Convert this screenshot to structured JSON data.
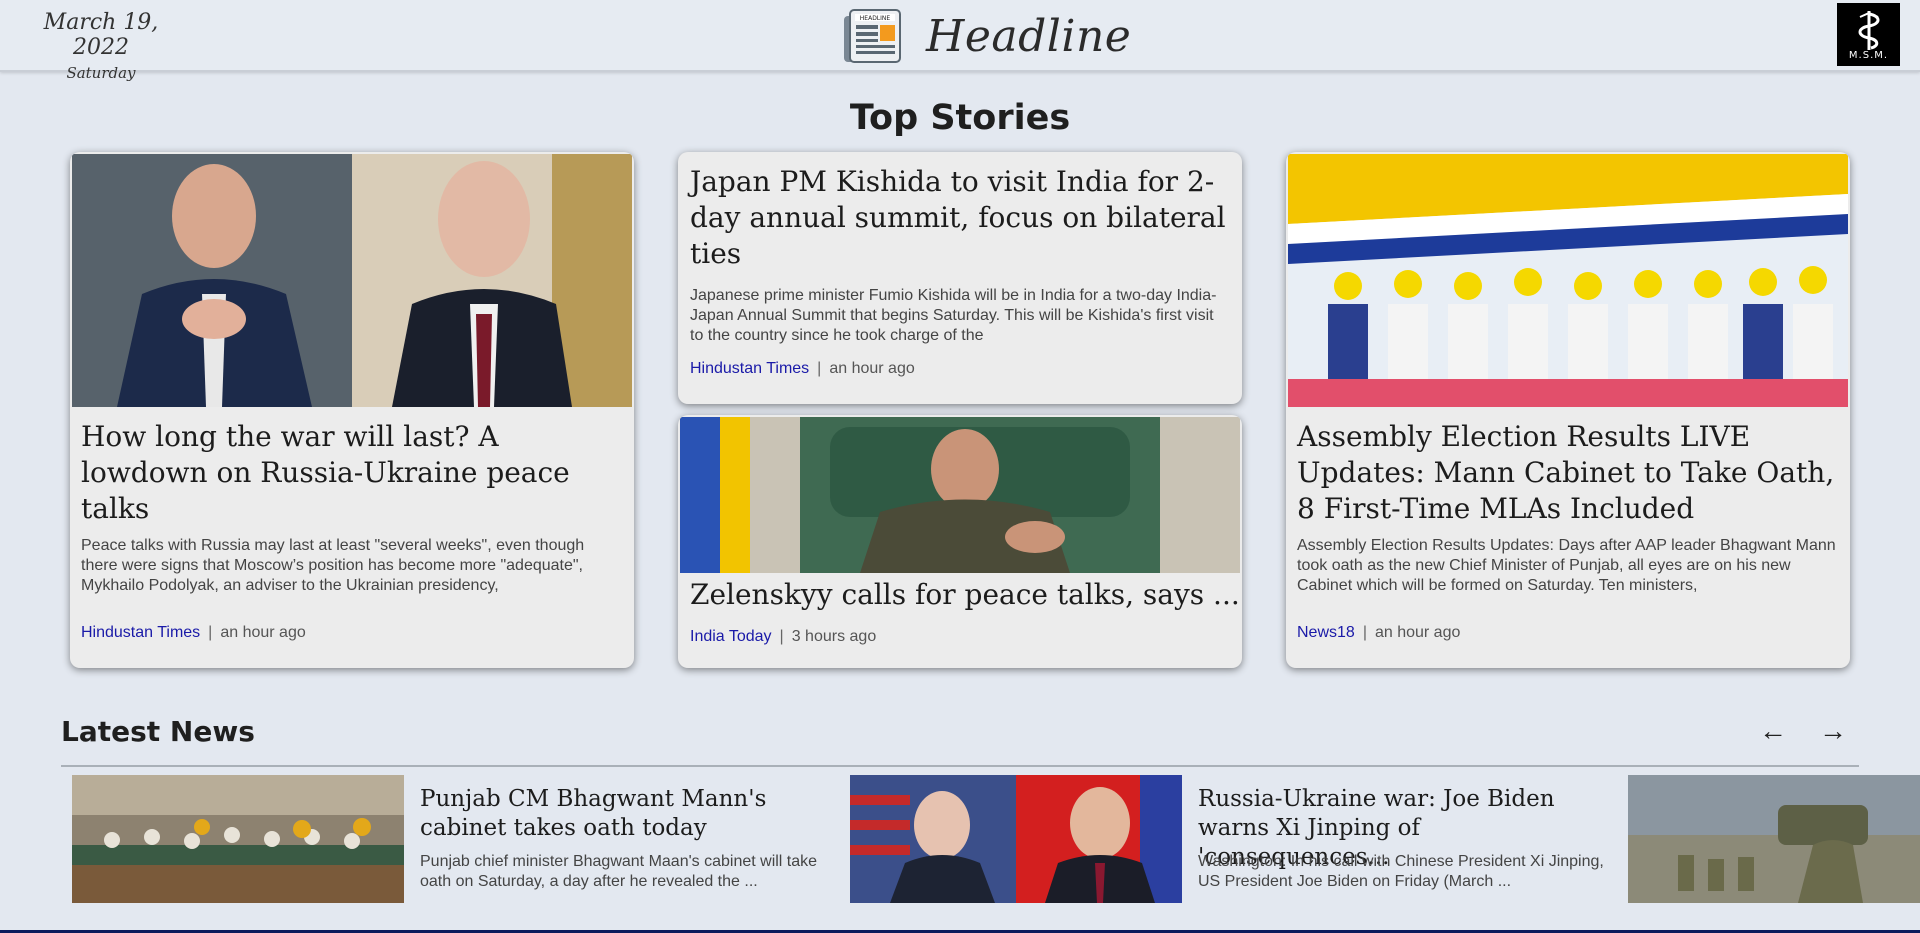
{
  "header": {
    "date": "March 19, 2022",
    "day": "Saturday",
    "site_title": "Headline",
    "logo_icon_text": "HEADLINE",
    "msm_logo_text": "M.S.M."
  },
  "top_stories": {
    "section_title": "Top Stories",
    "cards": [
      {
        "headline": "How long the war will last? A lowdown on Russia-Ukraine peace talks",
        "summary": "Peace talks with Russia may last at least \"several weeks\", even though there were signs that Moscow’s position has become more \"adequate\", Mykhailo Podolyak, an adviser to the Ukrainian presidency,",
        "source": "Hindustan Times",
        "time": "an hour ago"
      },
      {
        "headline": "Japan PM Kishida to visit India for 2-day annual summit, focus on bilateral ties",
        "summary": "Japanese prime minister Fumio Kishida will be in India for a two-day India-Japan Annual Summit that begins Saturday. This will be Kishida's first visit to the country since he took charge of the",
        "source": "Hindustan Times",
        "time": "an hour ago"
      },
      {
        "headline": "Zelenskyy calls for peace talks, says ...",
        "source": "India Today",
        "time": "3 hours ago"
      },
      {
        "headline": "Assembly Election Results LIVE Updates: Mann Cabinet to Take Oath, 8 First-Time MLAs Included",
        "summary": "Assembly Election Results Updates: Days after AAP leader Bhagwant Mann took oath as the new Chief Minister of Punjab, all eyes are on his new Cabinet which will be formed on Saturday. Ten ministers,",
        "source": "News18",
        "time": "an hour ago"
      }
    ]
  },
  "latest_news": {
    "section_title": "Latest News",
    "prev_label": "←",
    "next_label": "→",
    "items": [
      {
        "headline": "Punjab CM Bhagwant Mann's cabinet takes oath today",
        "summary": "Punjab chief minister Bhagwant Maan's cabinet will take oath on Saturday, a day after he revealed the ..."
      },
      {
        "headline": "Russia-Ukraine war: Joe Biden warns Xi Jinping of 'consequences...",
        "summary": "Washington: In his call with Chinese President Xi Jinping, US President Joe Biden on Friday (March ..."
      }
    ]
  },
  "colors": {
    "background": "#e3e8f0",
    "card": "#ececec",
    "source_link": "#1a1aa8",
    "bottom_bar": "#0b1a5c"
  }
}
